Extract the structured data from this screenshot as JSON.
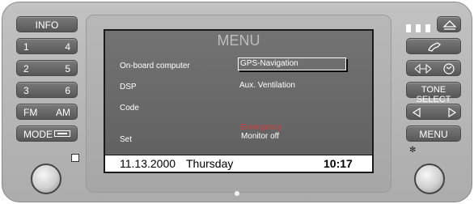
{
  "left_buttons": {
    "info": "INFO",
    "preset_1": "1",
    "preset_4": "4",
    "preset_2": "2",
    "preset_5": "5",
    "preset_3": "3",
    "preset_6": "6",
    "fm": "FM",
    "am": "AM",
    "mode": "MODE"
  },
  "screen": {
    "title": "MENU",
    "menu_left": [
      "On-board computer",
      "DSP",
      "Code",
      "Set"
    ],
    "menu_right": {
      "gps": "GPS-Navigation",
      "aux": "Aux. Ventilation",
      "emergency": "Emergency",
      "monitor": "Monitor off"
    },
    "status": {
      "date": "11.13.2000",
      "day": "Thursday",
      "time": "10:17"
    }
  },
  "right_buttons": {
    "tone_select": "TONE SELECT",
    "menu": "MENU"
  },
  "colors": {
    "emergency": "#d23b3b",
    "screen_bg": "#6a6a6a",
    "button": "#666666"
  }
}
